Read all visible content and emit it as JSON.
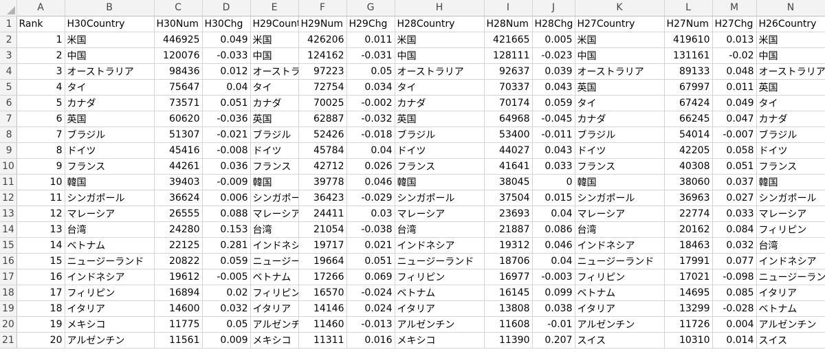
{
  "columns": [
    "A",
    "B",
    "C",
    "D",
    "E",
    "F",
    "G",
    "H",
    "I",
    "J",
    "K",
    "L",
    "M",
    "N"
  ],
  "headers": [
    "Rank",
    "H30Country",
    "H30Num",
    "H30Chg",
    "H29Country",
    "H29Num",
    "H29Chg",
    "H28Country",
    "H28Num",
    "H28Chg",
    "H27Country",
    "H27Num",
    "H27Chg",
    "H26Country"
  ],
  "rows": [
    [
      "1",
      "米国",
      "446925",
      "0.049",
      "米国",
      "426206",
      "0.011",
      "米国",
      "421665",
      "0.005",
      "米国",
      "419610",
      "0.013",
      "米国"
    ],
    [
      "2",
      "中国",
      "120076",
      "-0.033",
      "中国",
      "124162",
      "-0.031",
      "中国",
      "128111",
      "-0.023",
      "中国",
      "131161",
      "-0.02",
      "中国"
    ],
    [
      "3",
      "オーストラリア",
      "98436",
      "0.012",
      "オーストラ",
      "97223",
      "0.05",
      "オーストラリア",
      "92637",
      "0.039",
      "オーストラリア",
      "89133",
      "0.048",
      "オーストラリア"
    ],
    [
      "4",
      "タイ",
      "75647",
      "0.04",
      "タイ",
      "72754",
      "0.034",
      "タイ",
      "70337",
      "0.043",
      "英国",
      "67997",
      "0.011",
      "英国"
    ],
    [
      "5",
      "カナダ",
      "73571",
      "0.051",
      "カナダ",
      "70025",
      "-0.002",
      "カナダ",
      "70174",
      "0.059",
      "タイ",
      "67424",
      "0.049",
      "タイ"
    ],
    [
      "6",
      "英国",
      "60620",
      "-0.036",
      "英国",
      "62887",
      "-0.032",
      "英国",
      "64968",
      "-0.045",
      "カナダ",
      "66245",
      "0.047",
      "カナダ"
    ],
    [
      "7",
      "ブラジル",
      "51307",
      "-0.021",
      "ブラジル",
      "52426",
      "-0.018",
      "ブラジル",
      "53400",
      "-0.011",
      "ブラジル",
      "54014",
      "-0.007",
      "ブラジル"
    ],
    [
      "8",
      "ドイツ",
      "45416",
      "-0.008",
      "ドイツ",
      "45784",
      "0.04",
      "ドイツ",
      "44027",
      "0.043",
      "ドイツ",
      "42205",
      "0.058",
      "ドイツ"
    ],
    [
      "9",
      "フランス",
      "44261",
      "0.036",
      "フランス",
      "42712",
      "0.026",
      "フランス",
      "41641",
      "0.033",
      "フランス",
      "40308",
      "0.051",
      "フランス"
    ],
    [
      "10",
      "韓国",
      "39403",
      "-0.009",
      "韓国",
      "39778",
      "0.046",
      "韓国",
      "38045",
      "0",
      "韓国",
      "38060",
      "0.037",
      "韓国"
    ],
    [
      "11",
      "シンガポール",
      "36624",
      "0.006",
      "シンガポー",
      "36423",
      "-0.029",
      "シンガポール",
      "37504",
      "0.015",
      "シンガポール",
      "36963",
      "0.027",
      "シンガポール"
    ],
    [
      "12",
      "マレーシア",
      "26555",
      "0.088",
      "マレーシア",
      "24411",
      "0.03",
      "マレーシア",
      "23693",
      "0.04",
      "マレーシア",
      "22774",
      "0.033",
      "マレーシア"
    ],
    [
      "13",
      "台湾",
      "24280",
      "0.153",
      "台湾",
      "21054",
      "-0.038",
      "台湾",
      "21887",
      "0.086",
      "台湾",
      "20162",
      "0.084",
      "フィリピン"
    ],
    [
      "14",
      "ベトナム",
      "22125",
      "0.281",
      "インドネシ",
      "19717",
      "0.021",
      "インドネシア",
      "19312",
      "0.046",
      "インドネシア",
      "18463",
      "0.032",
      "台湾"
    ],
    [
      "15",
      "ニュージーランド",
      "20822",
      "0.059",
      "ニュージー",
      "19664",
      "0.051",
      "ニュージーランド",
      "18706",
      "0.04",
      "ニュージーランド",
      "17991",
      "0.077",
      "インドネシア"
    ],
    [
      "16",
      "インドネシア",
      "19612",
      "-0.005",
      "ベトナム",
      "17266",
      "0.069",
      "フィリピン",
      "16977",
      "-0.003",
      "フィリピン",
      "17021",
      "-0.098",
      "ニュージーラン"
    ],
    [
      "17",
      "フィリピン",
      "16894",
      "0.02",
      "フィリピン",
      "16570",
      "-0.024",
      "ベトナム",
      "16145",
      "0.099",
      "ベトナム",
      "14695",
      "0.085",
      "イタリア"
    ],
    [
      "18",
      "イタリア",
      "14600",
      "0.032",
      "イタリア",
      "14146",
      "0.024",
      "イタリア",
      "13808",
      "0.038",
      "イタリア",
      "13299",
      "-0.028",
      "ベトナム"
    ],
    [
      "19",
      "メキシコ",
      "11775",
      "0.05",
      "アルゼンチ",
      "11460",
      "-0.013",
      "アルゼンチン",
      "11608",
      "-0.01",
      "アルゼンチン",
      "11726",
      "0.004",
      "アルゼンチン"
    ],
    [
      "20",
      "アルゼンチン",
      "11561",
      "0.009",
      "メキシコ",
      "11311",
      "0.016",
      "メキシコ",
      "11390",
      "0.207",
      "スイス",
      "10310",
      "0.014",
      "スイス"
    ]
  ]
}
